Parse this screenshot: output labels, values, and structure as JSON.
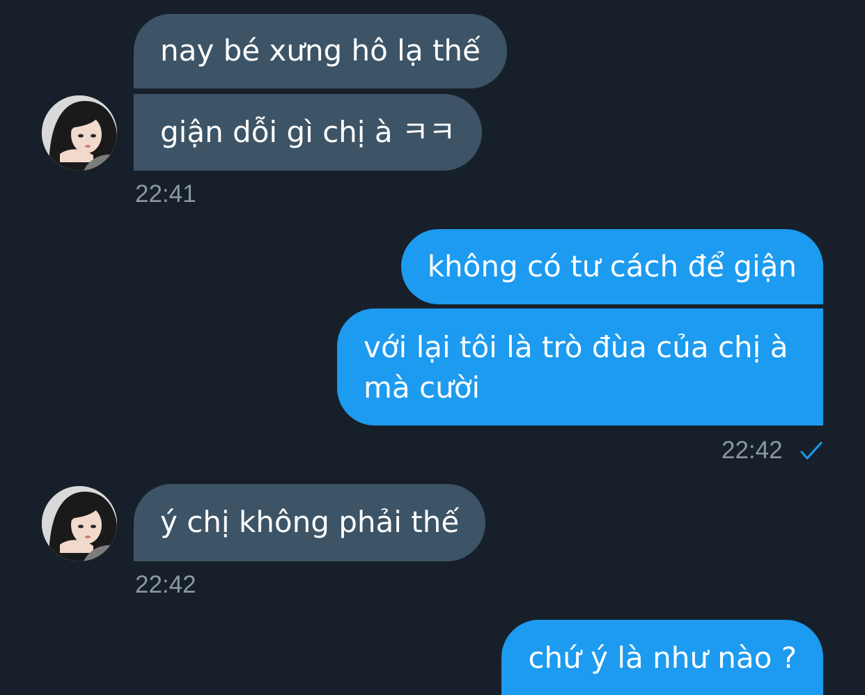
{
  "messages": [
    {
      "text": "nay bé xưng hô lạ thế"
    },
    {
      "text": "giận dỗi gì chị à ㅋㅋ"
    },
    {
      "text": "không có tư cách để giận"
    },
    {
      "text": "với lại tôi là trò đùa của chị à"
    },
    {
      "text": "mà cười"
    },
    {
      "text": "ý chị không phải thế"
    },
    {
      "text": "chứ ý là như nào ?"
    }
  ],
  "timestamps": {
    "group1": "22:41",
    "group2": "22:42",
    "group3": "22:42"
  },
  "icons": {
    "read_receipt": "checkmark-icon",
    "avatar": "contact-avatar"
  },
  "colors": {
    "background": "#17202a",
    "incoming_bubble": "#3d5466",
    "outgoing_bubble": "#1d9bf0",
    "timestamp": "#8b98a5",
    "check": "#1d9bf0"
  }
}
